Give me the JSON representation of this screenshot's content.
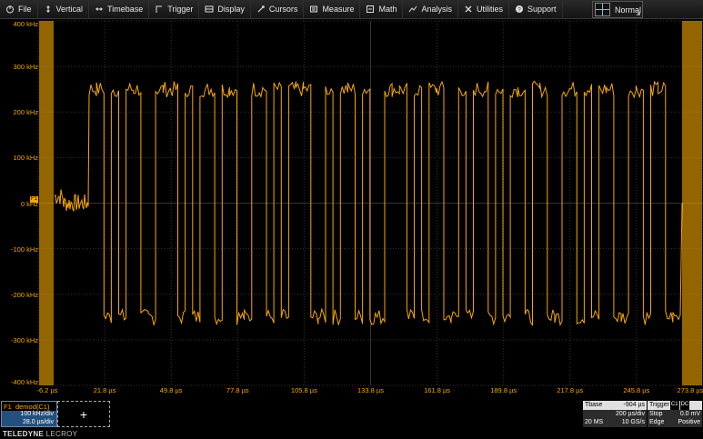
{
  "menu": [
    {
      "label": "File",
      "icon": "power-icon"
    },
    {
      "label": "Vertical",
      "icon": "vertical-arrows-icon"
    },
    {
      "label": "Timebase",
      "icon": "horizontal-arrows-icon"
    },
    {
      "label": "Trigger",
      "icon": "trigger-icon"
    },
    {
      "label": "Display",
      "icon": "display-icon"
    },
    {
      "label": "Cursors",
      "icon": "cursor-icon"
    },
    {
      "label": "Measure",
      "icon": "measure-icon"
    },
    {
      "label": "Math",
      "icon": "math-icon"
    },
    {
      "label": "Analysis",
      "icon": "analysis-icon"
    },
    {
      "label": "Utilities",
      "icon": "tools-icon"
    },
    {
      "label": "Support",
      "icon": "help-icon"
    }
  ],
  "trigger_mode": {
    "label": "Normal"
  },
  "colors": {
    "trace": "#f5a800",
    "grid": "#3a3a3a",
    "accent_blue": "#24507e"
  },
  "channel_tag": "F1",
  "chart_data": {
    "type": "line",
    "yticks": [
      "400 kHz",
      "300 kHz",
      "200 kHz",
      "100 kHz",
      "0 kHz",
      "-100 kHz",
      "-200 kHz",
      "-300 kHz",
      "-400 kHz"
    ],
    "xticks": [
      "-6.2 µs",
      "21.8 µs",
      "49.8 µs",
      "77.8 µs",
      "105.8 µs",
      "133.8 µs",
      "161.8 µs",
      "189.8 µs",
      "217.8 µs",
      "245.8 µs",
      "273.8 µs"
    ],
    "ylim": [
      -400,
      400
    ],
    "xlim": [
      -6.2,
      273.8
    ],
    "grid": true,
    "series": [
      {
        "name": "demod(C1)",
        "symbols": [
          1,
          1,
          -1,
          1,
          -1,
          1,
          1,
          -1,
          -1,
          1,
          1,
          1,
          -1,
          1,
          -1,
          1,
          1,
          -1,
          1,
          1,
          -1,
          -1,
          1,
          1,
          -1,
          1,
          -1,
          1,
          1,
          1,
          -1,
          -1,
          1,
          -1,
          1,
          1,
          -1,
          1,
          -1,
          -1,
          1,
          1,
          1,
          -1,
          1,
          -1,
          1,
          1,
          -1,
          -1,
          1,
          -1,
          1,
          1,
          -1,
          1,
          -1,
          1,
          1,
          -1,
          1,
          1,
          -1,
          -1,
          1,
          1,
          -1,
          1,
          -1,
          1,
          1,
          -1,
          -1,
          1,
          1,
          -1,
          1,
          1,
          -1,
          -1
        ]
      }
    ]
  },
  "f1": {
    "title": "F1",
    "source": "demod(C1)",
    "vscale": "100 kHz/div",
    "hscale": "28.0 µs/div"
  },
  "add_label": "+",
  "brand": {
    "main": "TELEDYNE",
    "sub": "LECROY"
  },
  "timebase": {
    "label": "Tbase",
    "delay": "-904 µs",
    "scale": "200 µs/div",
    "samples": "20 MS",
    "rate": "10 GS/s"
  },
  "trigger": {
    "label": "Trigger",
    "badge1": "C1",
    "badge2": "DC",
    "mode": "Stop",
    "level": "0.0 mV",
    "type": "Edge",
    "slope": "Positive"
  }
}
